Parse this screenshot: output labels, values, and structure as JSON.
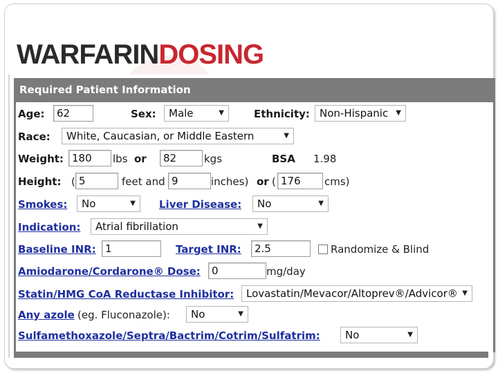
{
  "logo": {
    "part1": "WARFARIN",
    "part2": "DOSING"
  },
  "panel": {
    "title": "Required Patient Information"
  },
  "age": {
    "label": "Age:",
    "value": "62"
  },
  "sex": {
    "label": "Sex:",
    "value": "Male"
  },
  "ethnicity": {
    "label": "Ethnicity:",
    "value": "Non-Hispanic"
  },
  "race": {
    "label": "Race:",
    "value": "White, Caucasian, or Middle Eastern"
  },
  "weight": {
    "label": "Weight:",
    "lbs_value": "180",
    "lbs_unit": "lbs",
    "or": "or",
    "kgs_value": "82",
    "kgs_unit": "kgs"
  },
  "bsa": {
    "label": "BSA",
    "value": "1.98"
  },
  "height": {
    "label": "Height:",
    "open": "(",
    "feet_value": "5",
    "feet_unit": "feet and",
    "inches_value": "9",
    "inches_unit": "inches)",
    "or": "or",
    "open2": "(",
    "cm_value": "176",
    "cm_unit": "cms)"
  },
  "smokes": {
    "label": "Smokes:",
    "value": "No"
  },
  "liver": {
    "label": "Liver Disease:",
    "value": "No"
  },
  "indication": {
    "label": "Indication:",
    "value": "Atrial fibrillation"
  },
  "baseline_inr": {
    "label": "Baseline INR:",
    "value": "1"
  },
  "target_inr": {
    "label": "Target INR:",
    "value": "2.5"
  },
  "randomize": {
    "label": "Randomize & Blind",
    "checked": false
  },
  "amiodarone": {
    "label": "Amiodarone/Cordarone® Dose:",
    "value": "0",
    "unit": "mg/day"
  },
  "statin": {
    "label": "Statin/HMG CoA Reductase Inhibitor:",
    "value": "Lovastatin/Mevacor/Altoprev®/Advicor®"
  },
  "azole": {
    "label": "Any azole",
    "note": "(eg. Fluconazole):",
    "value": "No"
  },
  "sulfa": {
    "label": "Sulfamethoxazole/Septra/Bactrim/Cotrim/Sulfatrim:",
    "value": "No"
  },
  "colors": {
    "header": "#7b7b7b",
    "link": "#1f2f9f",
    "logo_dark": "#2a2a2a",
    "logo_red": "#c8272f"
  },
  "icons": {
    "dropdown": "chevron-down-icon"
  }
}
